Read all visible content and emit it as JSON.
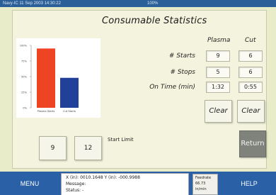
{
  "titlebar": {
    "left_text": "Navy-IC   11 Sep 2003  14:30:22",
    "mid_text": "100%"
  },
  "page": {
    "title": "Consumable Statistics"
  },
  "table": {
    "columns": [
      "Plasma",
      "Cut"
    ],
    "rows": [
      {
        "label": "# Starts",
        "values": [
          "9",
          "6"
        ]
      },
      {
        "label": "# Stops",
        "values": [
          "5",
          "6"
        ]
      },
      {
        "label": "On Time (min)",
        "values": [
          "1:32",
          "0:55"
        ]
      }
    ],
    "clear_label": "Clear"
  },
  "start_limit": {
    "label": "Start Limit",
    "values": [
      "9",
      "12"
    ]
  },
  "return_label": "Return",
  "bottom": {
    "menu_label": "MENU",
    "help_label": "HELP",
    "status": {
      "coords": "X (in): 0010.1648   Y (in): -000.9988",
      "message": "Message:",
      "status": "Status:  -"
    },
    "feedrate": {
      "label": "Feedrate",
      "value": "66.73",
      "unit": "in/min"
    }
  },
  "chart_data": {
    "type": "bar",
    "categories": [
      "Plasma Starts",
      "Cut Starts"
    ],
    "values": [
      95,
      48
    ],
    "colors": [
      "#ee4424",
      "#21409a"
    ],
    "yticks": [
      "100%",
      "75%",
      "50%",
      "25%",
      "0%"
    ],
    "ylim": [
      0,
      100
    ],
    "grid": false
  }
}
